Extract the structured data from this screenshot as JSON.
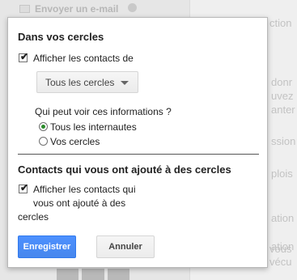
{
  "background": {
    "top_item_label": "Envoyer un e-mail",
    "right_snippets": [
      "ction",
      "donr",
      "uvez",
      "anter",
      "ssion",
      "plois",
      "ation",
      "ation",
      "vous",
      "vécu"
    ]
  },
  "dialog": {
    "section1_title": "Dans vos cercles",
    "show_contacts_label": "Afficher les contacts de",
    "show_contacts_checked": true,
    "circles_select_value": "Tous les cercles",
    "visibility_question": "Qui peut voir ces informations ?",
    "visibility_options": [
      {
        "label": "Tous les internautes",
        "selected": true
      },
      {
        "label": "Vos cercles",
        "selected": false
      }
    ],
    "section2_title": "Contacts qui vous ont ajouté à des cercles",
    "show_added_line1": "Afficher les contacts qui",
    "show_added_line2": "vous ont ajouté à des",
    "show_added_line3": "cercles",
    "show_added_checked": true,
    "save_label": "Enregistrer",
    "cancel_label": "Annuler"
  },
  "colors": {
    "primary_button": "#4d90fe",
    "radio_selected": "#2a8a2a"
  }
}
